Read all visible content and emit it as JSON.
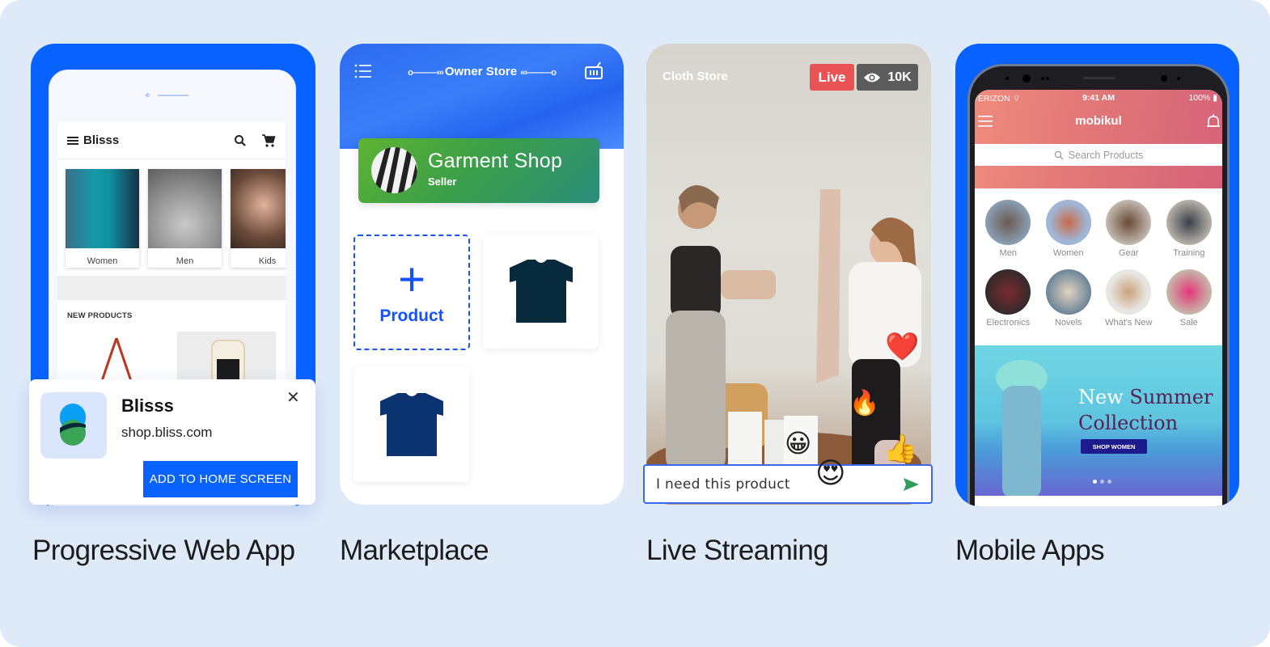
{
  "cards": [
    {
      "title": "Progressive Web App",
      "app": {
        "brand": "Blisss",
        "categories": [
          "Women",
          "Men",
          "Kids"
        ],
        "section_title": "NEW PRODUCTS"
      },
      "install_prompt": {
        "app_name": "Blisss",
        "url": "shop.bliss.com",
        "close_icon": "close-icon",
        "button_label": "ADD TO HOME SCREEN"
      }
    },
    {
      "title": "Marketplace",
      "header": {
        "title": "Owner Store",
        "menu_icon": "list-icon",
        "cart_icon": "basket-icon"
      },
      "seller": {
        "name": "Garment Shop",
        "role": "Seller"
      },
      "add_product_label": "Product",
      "products": [
        {
          "icon": "tshirt-icon",
          "color": "#072a3c"
        },
        {
          "icon": "tshirt-icon",
          "color": "#0a336f"
        }
      ]
    },
    {
      "title": "Live Streaming",
      "store_name": "Cloth Store",
      "live_badge": "Live",
      "viewer_count": "10K",
      "chat_input": {
        "value": "I need this product"
      },
      "reactions": [
        "❤️",
        "🔥",
        "😀",
        "👍",
        "😍"
      ]
    },
    {
      "title": "Mobile Apps",
      "status_bar": {
        "carrier": "VERIZON",
        "time": "9:41 AM",
        "battery": "100%"
      },
      "brand": "mobikul",
      "search_placeholder": "Search Products",
      "categories": [
        "Men",
        "Women",
        "Gear",
        "Training",
        "Electronics",
        "Novels",
        "What's New",
        "Sale"
      ],
      "banner": {
        "title_word1": "New",
        "title_word2": "Summer",
        "title_line2": "Collection",
        "button_label": "SHOP WOMEN",
        "slide_index": 1,
        "slide_count": 3
      }
    }
  ],
  "colors": {
    "background": "#dfeaf9",
    "accent_blue": "#0762ff",
    "live_red": "#ea5356",
    "seller_green": "#3a9d4c"
  }
}
